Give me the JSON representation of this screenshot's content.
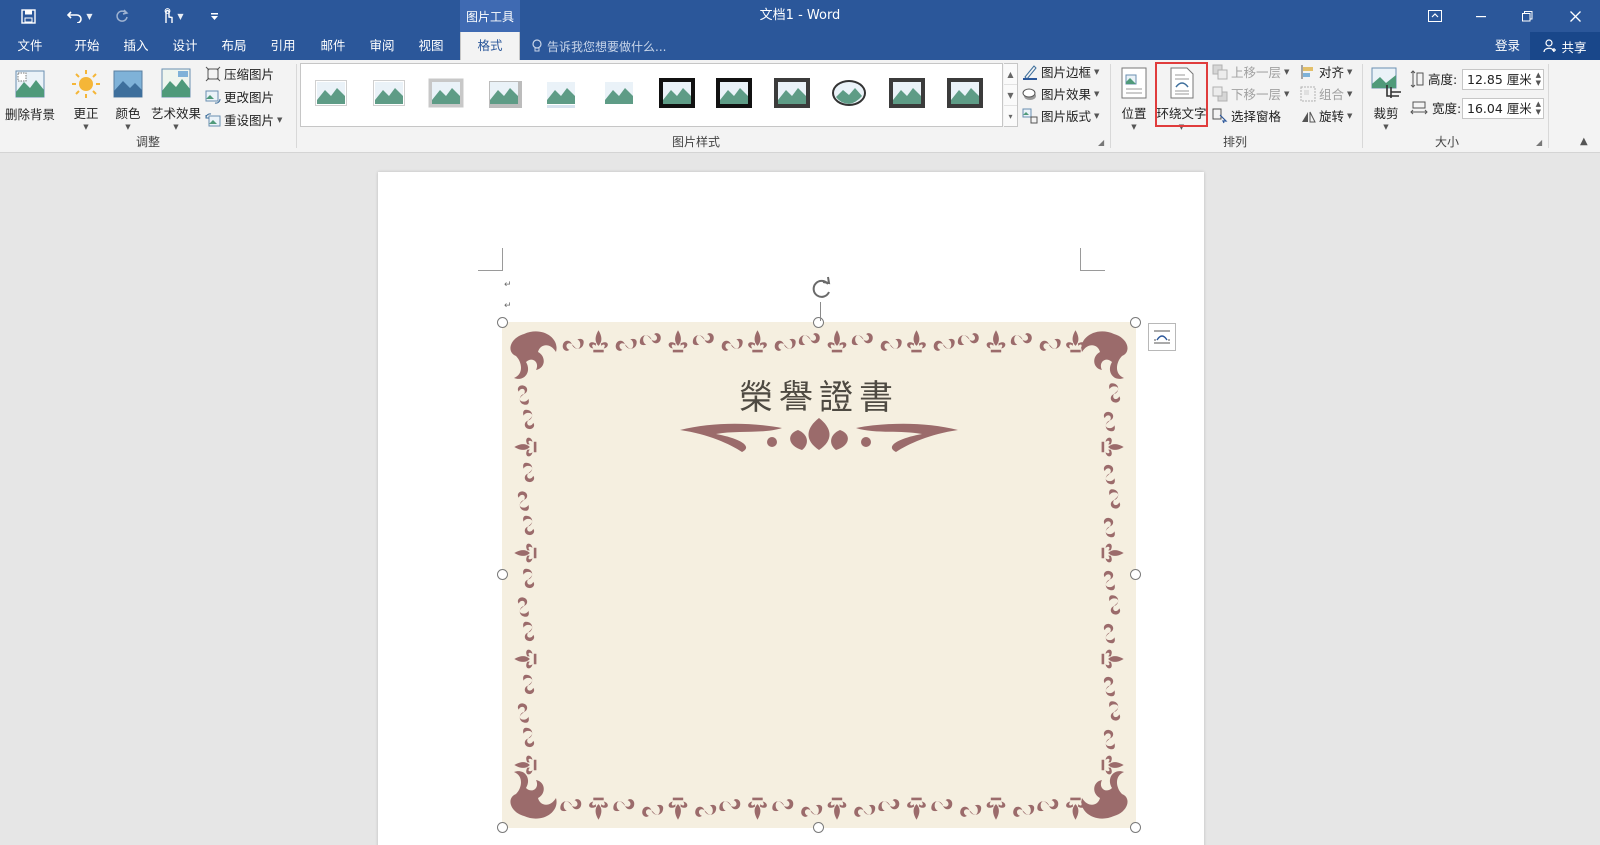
{
  "window": {
    "doc_title": "文档1 - Word",
    "context_tool_label": "图片工具"
  },
  "quick_access": {
    "save_icon": "save-icon",
    "undo_icon": "undo-icon",
    "redo_icon": "redo-icon",
    "touch_icon": "touch-mode-icon",
    "customize_icon": "customize-icon"
  },
  "tabs": [
    {
      "label": "文件"
    },
    {
      "label": "开始"
    },
    {
      "label": "插入"
    },
    {
      "label": "设计"
    },
    {
      "label": "布局"
    },
    {
      "label": "引用"
    },
    {
      "label": "邮件"
    },
    {
      "label": "审阅"
    },
    {
      "label": "视图"
    },
    {
      "label": "格式",
      "active": true
    }
  ],
  "tell_me": {
    "placeholder": "告诉我您想要做什么..."
  },
  "account": {
    "signin": "登录",
    "share": "共享"
  },
  "ribbon": {
    "adjust": {
      "label": "调整",
      "remove_bg": "删除背景",
      "corrections": "更正",
      "color": "颜色",
      "artistic": "艺术效果",
      "compress": "压缩图片",
      "change": "更改图片",
      "reset": "重设图片"
    },
    "styles": {
      "label": "图片样式",
      "border": "图片边框",
      "effects": "图片效果",
      "layout": "图片版式",
      "thumb_count": 12
    },
    "arrange": {
      "label": "排列",
      "position": "位置",
      "wrap_text": "环绕文字",
      "bring_forward": "上移一层",
      "send_backward": "下移一层",
      "selection_pane": "选择窗格",
      "align": "对齐",
      "group": "组合",
      "rotate": "旋转"
    },
    "size": {
      "label": "大小",
      "crop": "裁剪",
      "height_label": "高度:",
      "height_value": "12.85 厘米",
      "width_label": "宽度:",
      "width_value": "16.04 厘米"
    }
  },
  "document": {
    "certificate_title": "榮譽證書",
    "certificate_colors": {
      "background": "#f5efe0",
      "ornament": "#9b6b6b"
    }
  },
  "colors": {
    "word_blue": "#2b579a",
    "ribbon_bg": "#f3f3f3",
    "highlight_red": "#e03c3c"
  }
}
